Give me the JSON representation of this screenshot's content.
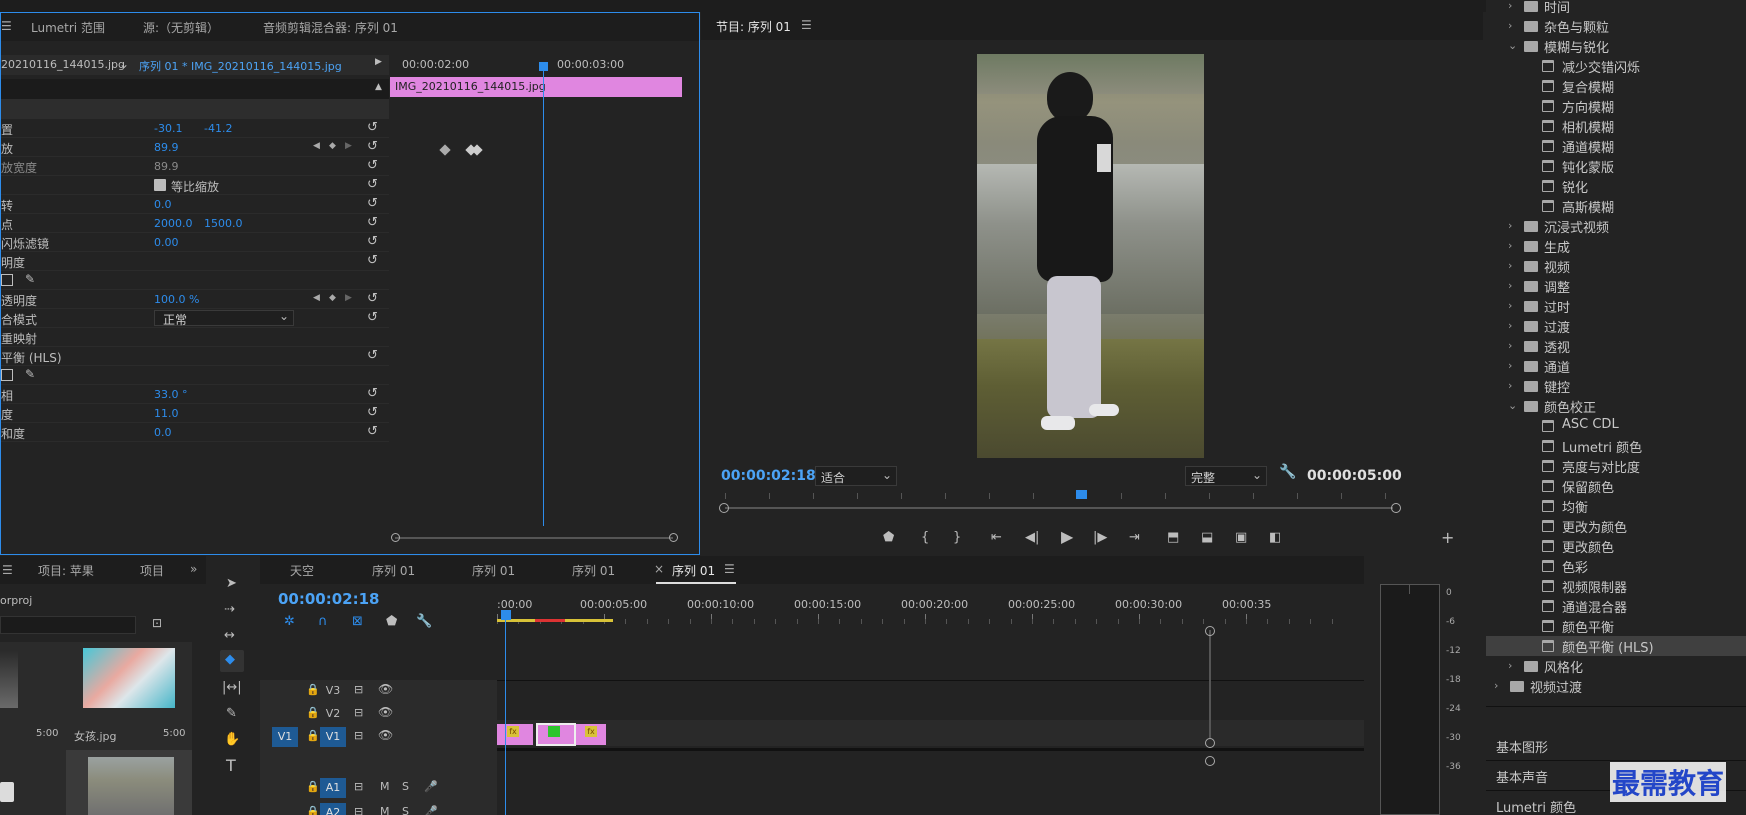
{
  "effect_controls": {
    "tabs": [
      "Lumetri 范围",
      "源:（无剪辑）",
      "音频剪辑混合器: 序列 01"
    ],
    "clip_source": "20210116_144015.jpg",
    "clip_target": "序列 01 * IMG_20210116_144015.jpg",
    "ruler_left": "00:00:02:00",
    "ruler_right": "00:00:03:00",
    "clip_bar_label": "IMG_20210116_144015.jpg",
    "properties": [
      {
        "label": "置",
        "v1": "-30.1",
        "v2": "-41.2"
      },
      {
        "label": "放",
        "v1": "89.9",
        "v2": ""
      },
      {
        "label": "放宽度",
        "v1": "89.9",
        "v2": "",
        "dim": true
      },
      {
        "label": "",
        "checkbox": "等比缩放"
      },
      {
        "label": "转",
        "v1": "0.0",
        "v2": ""
      },
      {
        "label": "点",
        "v1": "2000.0",
        "v2": "1500.0"
      },
      {
        "label": "闪烁滤镜",
        "v1": "0.00",
        "v2": ""
      },
      {
        "label": "明度",
        "v1": "",
        "v2": ""
      },
      {
        "label": "",
        "tools": true
      },
      {
        "label": "透明度",
        "v1": "100.0 %",
        "v2": ""
      },
      {
        "label": "合模式",
        "dropdown": "正常"
      },
      {
        "label": "重映射",
        "v1": "",
        "v2": ""
      },
      {
        "label": "平衡 (HLS)",
        "v1": "",
        "v2": ""
      },
      {
        "label": "",
        "tools": true
      },
      {
        "label": "相",
        "v1": "33.0 °",
        "v2": ""
      },
      {
        "label": "度",
        "v1": "11.0",
        "v2": ""
      },
      {
        "label": "和度",
        "v1": "0.0",
        "v2": ""
      }
    ]
  },
  "program_monitor": {
    "title": "节目: 序列 01",
    "timecode": "00:00:02:18",
    "fit": "适合",
    "quality": "完整",
    "duration": "00:00:05:00"
  },
  "effects_tree": {
    "items": [
      {
        "label": "时间",
        "level": 1,
        "type": "folder",
        "open": false
      },
      {
        "label": "杂色与颗粒",
        "level": 1,
        "type": "folder",
        "open": false
      },
      {
        "label": "模糊与锐化",
        "level": 1,
        "type": "folder",
        "open": true
      },
      {
        "label": "减少交错闪烁",
        "level": 2,
        "type": "fx"
      },
      {
        "label": "复合模糊",
        "level": 2,
        "type": "fx"
      },
      {
        "label": "方向模糊",
        "level": 2,
        "type": "fx"
      },
      {
        "label": "相机模糊",
        "level": 2,
        "type": "fx"
      },
      {
        "label": "通道模糊",
        "level": 2,
        "type": "fx"
      },
      {
        "label": "钝化蒙版",
        "level": 2,
        "type": "fx"
      },
      {
        "label": "锐化",
        "level": 2,
        "type": "fx"
      },
      {
        "label": "高斯模糊",
        "level": 2,
        "type": "fx"
      },
      {
        "label": "沉浸式视频",
        "level": 1,
        "type": "folder",
        "open": false
      },
      {
        "label": "生成",
        "level": 1,
        "type": "folder",
        "open": false
      },
      {
        "label": "视频",
        "level": 1,
        "type": "folder",
        "open": false
      },
      {
        "label": "调整",
        "level": 1,
        "type": "folder",
        "open": false
      },
      {
        "label": "过时",
        "level": 1,
        "type": "folder",
        "open": false
      },
      {
        "label": "过渡",
        "level": 1,
        "type": "folder",
        "open": false
      },
      {
        "label": "透视",
        "level": 1,
        "type": "folder",
        "open": false
      },
      {
        "label": "通道",
        "level": 1,
        "type": "folder",
        "open": false
      },
      {
        "label": "键控",
        "level": 1,
        "type": "folder",
        "open": false
      },
      {
        "label": "颜色校正",
        "level": 1,
        "type": "folder",
        "open": true
      },
      {
        "label": "ASC CDL",
        "level": 2,
        "type": "fx"
      },
      {
        "label": "Lumetri 颜色",
        "level": 2,
        "type": "fx"
      },
      {
        "label": "亮度与对比度",
        "level": 2,
        "type": "fx"
      },
      {
        "label": "保留颜色",
        "level": 2,
        "type": "fx"
      },
      {
        "label": "均衡",
        "level": 2,
        "type": "fx"
      },
      {
        "label": "更改为颜色",
        "level": 2,
        "type": "fx"
      },
      {
        "label": "更改颜色",
        "level": 2,
        "type": "fx"
      },
      {
        "label": "色彩",
        "level": 2,
        "type": "fx"
      },
      {
        "label": "视频限制器",
        "level": 2,
        "type": "fx"
      },
      {
        "label": "通道混合器",
        "level": 2,
        "type": "fx"
      },
      {
        "label": "颜色平衡",
        "level": 2,
        "type": "fx"
      },
      {
        "label": "颜色平衡 (HLS)",
        "level": 2,
        "type": "fx",
        "selected": true
      },
      {
        "label": "风格化",
        "level": 1,
        "type": "folder",
        "open": false
      },
      {
        "label": "视频过渡",
        "level": 0,
        "type": "folder",
        "open": false
      }
    ],
    "sections": [
      "基本图形",
      "基本声音",
      "Lumetri 颜色"
    ]
  },
  "project_panel": {
    "tabs": [
      "项目: 苹果",
      "项目"
    ],
    "filename": "orproj",
    "thumb_label_1": "5:00",
    "thumb_label_2": "女孩.jpg",
    "thumb_label_3": "5:00"
  },
  "timeline": {
    "tabs": [
      "天空",
      "序列 01",
      "序列 01",
      "序列 01",
      "序列 01"
    ],
    "timecode": "00:00:02:18",
    "ruler": [
      ":00:00",
      "00:00:05:00",
      "00:00:10:00",
      "00:00:15:00",
      "00:00:20:00",
      "00:00:25:00",
      "00:00:30:00",
      "00:00:35"
    ],
    "tracks": [
      "V3",
      "V2",
      "V1",
      "A1",
      "A2"
    ],
    "source_patch": "V1",
    "m_label": "M",
    "s_label": "S",
    "fx_label": "fx"
  },
  "meter": {
    "ticks": [
      "0",
      "-6",
      "-12",
      "-18",
      "-24",
      "-30",
      "-36"
    ]
  },
  "watermark": "最需教育"
}
